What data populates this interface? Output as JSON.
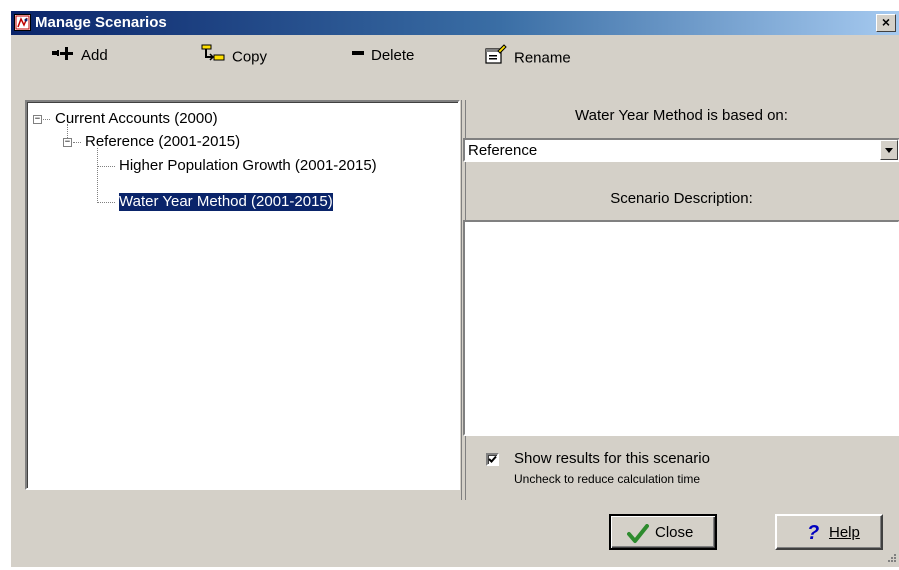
{
  "window": {
    "title": "Manage Scenarios",
    "close_glyph": "×"
  },
  "toolbar": {
    "add": {
      "label": "Add",
      "icon": "add-icon"
    },
    "copy": {
      "label": "Copy",
      "icon": "copy-icon"
    },
    "delete": {
      "label": "Delete",
      "icon": "delete-icon"
    },
    "rename": {
      "label": "Rename",
      "icon": "rename-icon"
    }
  },
  "tree": {
    "nodes": [
      {
        "label": "Current Accounts (2000)",
        "expander": "-",
        "level": 0
      },
      {
        "label": "Reference (2001-2015)",
        "expander": "-",
        "level": 1
      },
      {
        "label": "Higher Population Growth (2001-2015)",
        "level": 2
      },
      {
        "label": "Water Year Method (2001-2015)",
        "level": 2,
        "selected": true
      }
    ]
  },
  "right_panel": {
    "based_on_label": "Water Year Method is based on:",
    "based_on_value": "Reference",
    "description_label": "Scenario Description:",
    "description_value": "",
    "show_results_label": "Show results for this scenario",
    "show_results_checked": true,
    "hint": "Uncheck to reduce calculation time"
  },
  "buttons": {
    "close_label": "Close",
    "help_label": "Help"
  },
  "colors": {
    "titlebar_start": "#0a246a",
    "titlebar_end": "#a6caf0",
    "face": "#d4d0c8",
    "selection": "#0a246a"
  }
}
